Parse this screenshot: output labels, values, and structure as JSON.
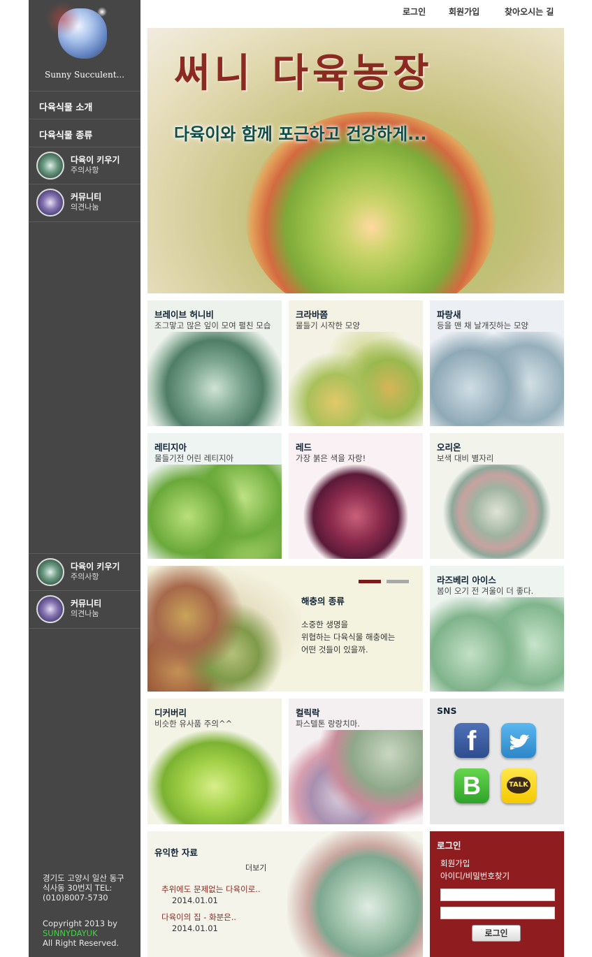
{
  "sidebar": {
    "logo_text": "Sunny Succulent...",
    "items": [
      {
        "label": "다육식물 소개"
      },
      {
        "label": "다육식물 종류"
      }
    ],
    "image_items": [
      {
        "title": "다육이 키우기",
        "subtitle": "주의사항"
      },
      {
        "title": "커뮤니티",
        "subtitle": "의견나눔"
      }
    ],
    "image_items_bottom": [
      {
        "title": "다육이 키우기",
        "subtitle": "주의사항"
      },
      {
        "title": "커뮤니티",
        "subtitle": "의견나눔"
      }
    ],
    "footer": {
      "address": [
        "경기도 고양시 일산 동구",
        "식사동 30번지 TEL:",
        "(010)8007-5730"
      ],
      "copyright": "Copyright 2013 by",
      "brand": "SUNNYDAYUK",
      "rights": "All Right Reserved."
    }
  },
  "topnav": {
    "login": "로그인",
    "signup": "회원가입",
    "directions": "찾아오시는 길"
  },
  "banner": {
    "title": "써니 다육농장",
    "subtitle": "다육이와 함께 포근하고 건강하게..."
  },
  "cards": [
    {
      "title": "브레이브 허니비",
      "sub": "조그맣고 많은 잎이 모여 펼친 모습"
    },
    {
      "title": "크라바쯤",
      "sub": "물들기 시작한 모양"
    },
    {
      "title": "파랑새",
      "sub": "등을 맨 채 날개짓하는 모양"
    },
    {
      "title": "레티지아",
      "sub": "물들기전 어린 레티지아"
    },
    {
      "title": "레드",
      "sub": "가장 붉은 색을 자랑!"
    },
    {
      "title": "오리온",
      "sub": "보색 대비 별자리"
    },
    {
      "title": "라즈베리 아이스",
      "sub": "봄이 오기 전 겨울이 더 좋다."
    },
    {
      "title": "디커버리",
      "sub": "비슷한 유사품 주의^^"
    },
    {
      "title": "컬릭락",
      "sub": "파스텔톤 랑랑치마."
    }
  ],
  "pest": {
    "title": "해충의 종류",
    "lines": [
      "소중한 생명을",
      "위협하는 다육식물 해충에는",
      "어떤 것들이 있을까."
    ]
  },
  "sns": {
    "title": "SNS",
    "icons": [
      "facebook-icon",
      "twitter-icon",
      "band-icon",
      "kakaotalk-icon"
    ],
    "talk_label": "TALK",
    "band_label": "B",
    "fb_label": "f"
  },
  "resources": {
    "title": "유익한 자료",
    "more": "더보기",
    "posts": [
      {
        "title": "추위에도 문제없는 다육이로..",
        "date": "2014.01.01"
      },
      {
        "title": "다육이의 집 - 화분은..",
        "date": "2014.01.01"
      }
    ]
  },
  "login": {
    "title": "로그인",
    "signup": "회원가입",
    "find": "아이디/비밀번호찾기",
    "button": "로그인"
  },
  "colors": {
    "sidebar": "#464646",
    "login_panel": "#8f1c1e",
    "accent_green": "#3fd83f"
  }
}
